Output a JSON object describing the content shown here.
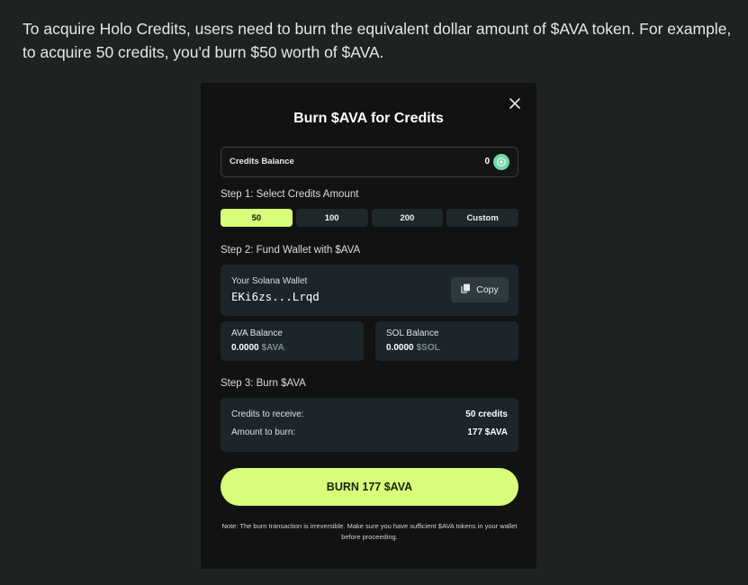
{
  "intro": "To acquire Holo Credits, users need to burn the equivalent dollar amount of $AVA token. For example, to acquire 50 credits, you'd burn $50 worth of $AVA.",
  "modal": {
    "title": "Burn $AVA for Credits",
    "close_icon": "close-icon",
    "credits_balance": {
      "label": "Credits Balance",
      "value": "0",
      "icon": "credits-coin-icon"
    },
    "step1": {
      "heading": "Step 1: Select Credits Amount",
      "options": [
        "50",
        "100",
        "200",
        "Custom"
      ],
      "selected": "50"
    },
    "step2": {
      "heading": "Step 2: Fund Wallet with $AVA",
      "wallet_label": "Your Solana Wallet",
      "wallet_address": "EKi6zs...Lrqd",
      "copy_label": "Copy",
      "ava_balance": {
        "label": "AVA Balance",
        "value": "0.0000",
        "unit": "$AVA"
      },
      "sol_balance": {
        "label": "SOL Balance",
        "value": "0.0000",
        "unit": "$SOL"
      }
    },
    "step3": {
      "heading": "Step 3: Burn $AVA",
      "credits_label": "Credits to receive:",
      "credits_value": "50 credits",
      "amount_label": "Amount to burn:",
      "amount_value": "177 $AVA"
    },
    "burn_button": "BURN 177 $AVA",
    "note": "Note: The burn transaction is irreversible. Make sure you have sufficient $AVA tokens in your wallet before proceeding."
  },
  "colors": {
    "page_bg": "#1e2322",
    "modal_bg": "#121212",
    "accent": "#d7fd7a",
    "card_bg": "#1b252a",
    "credits_icon": "#70d8a6"
  }
}
